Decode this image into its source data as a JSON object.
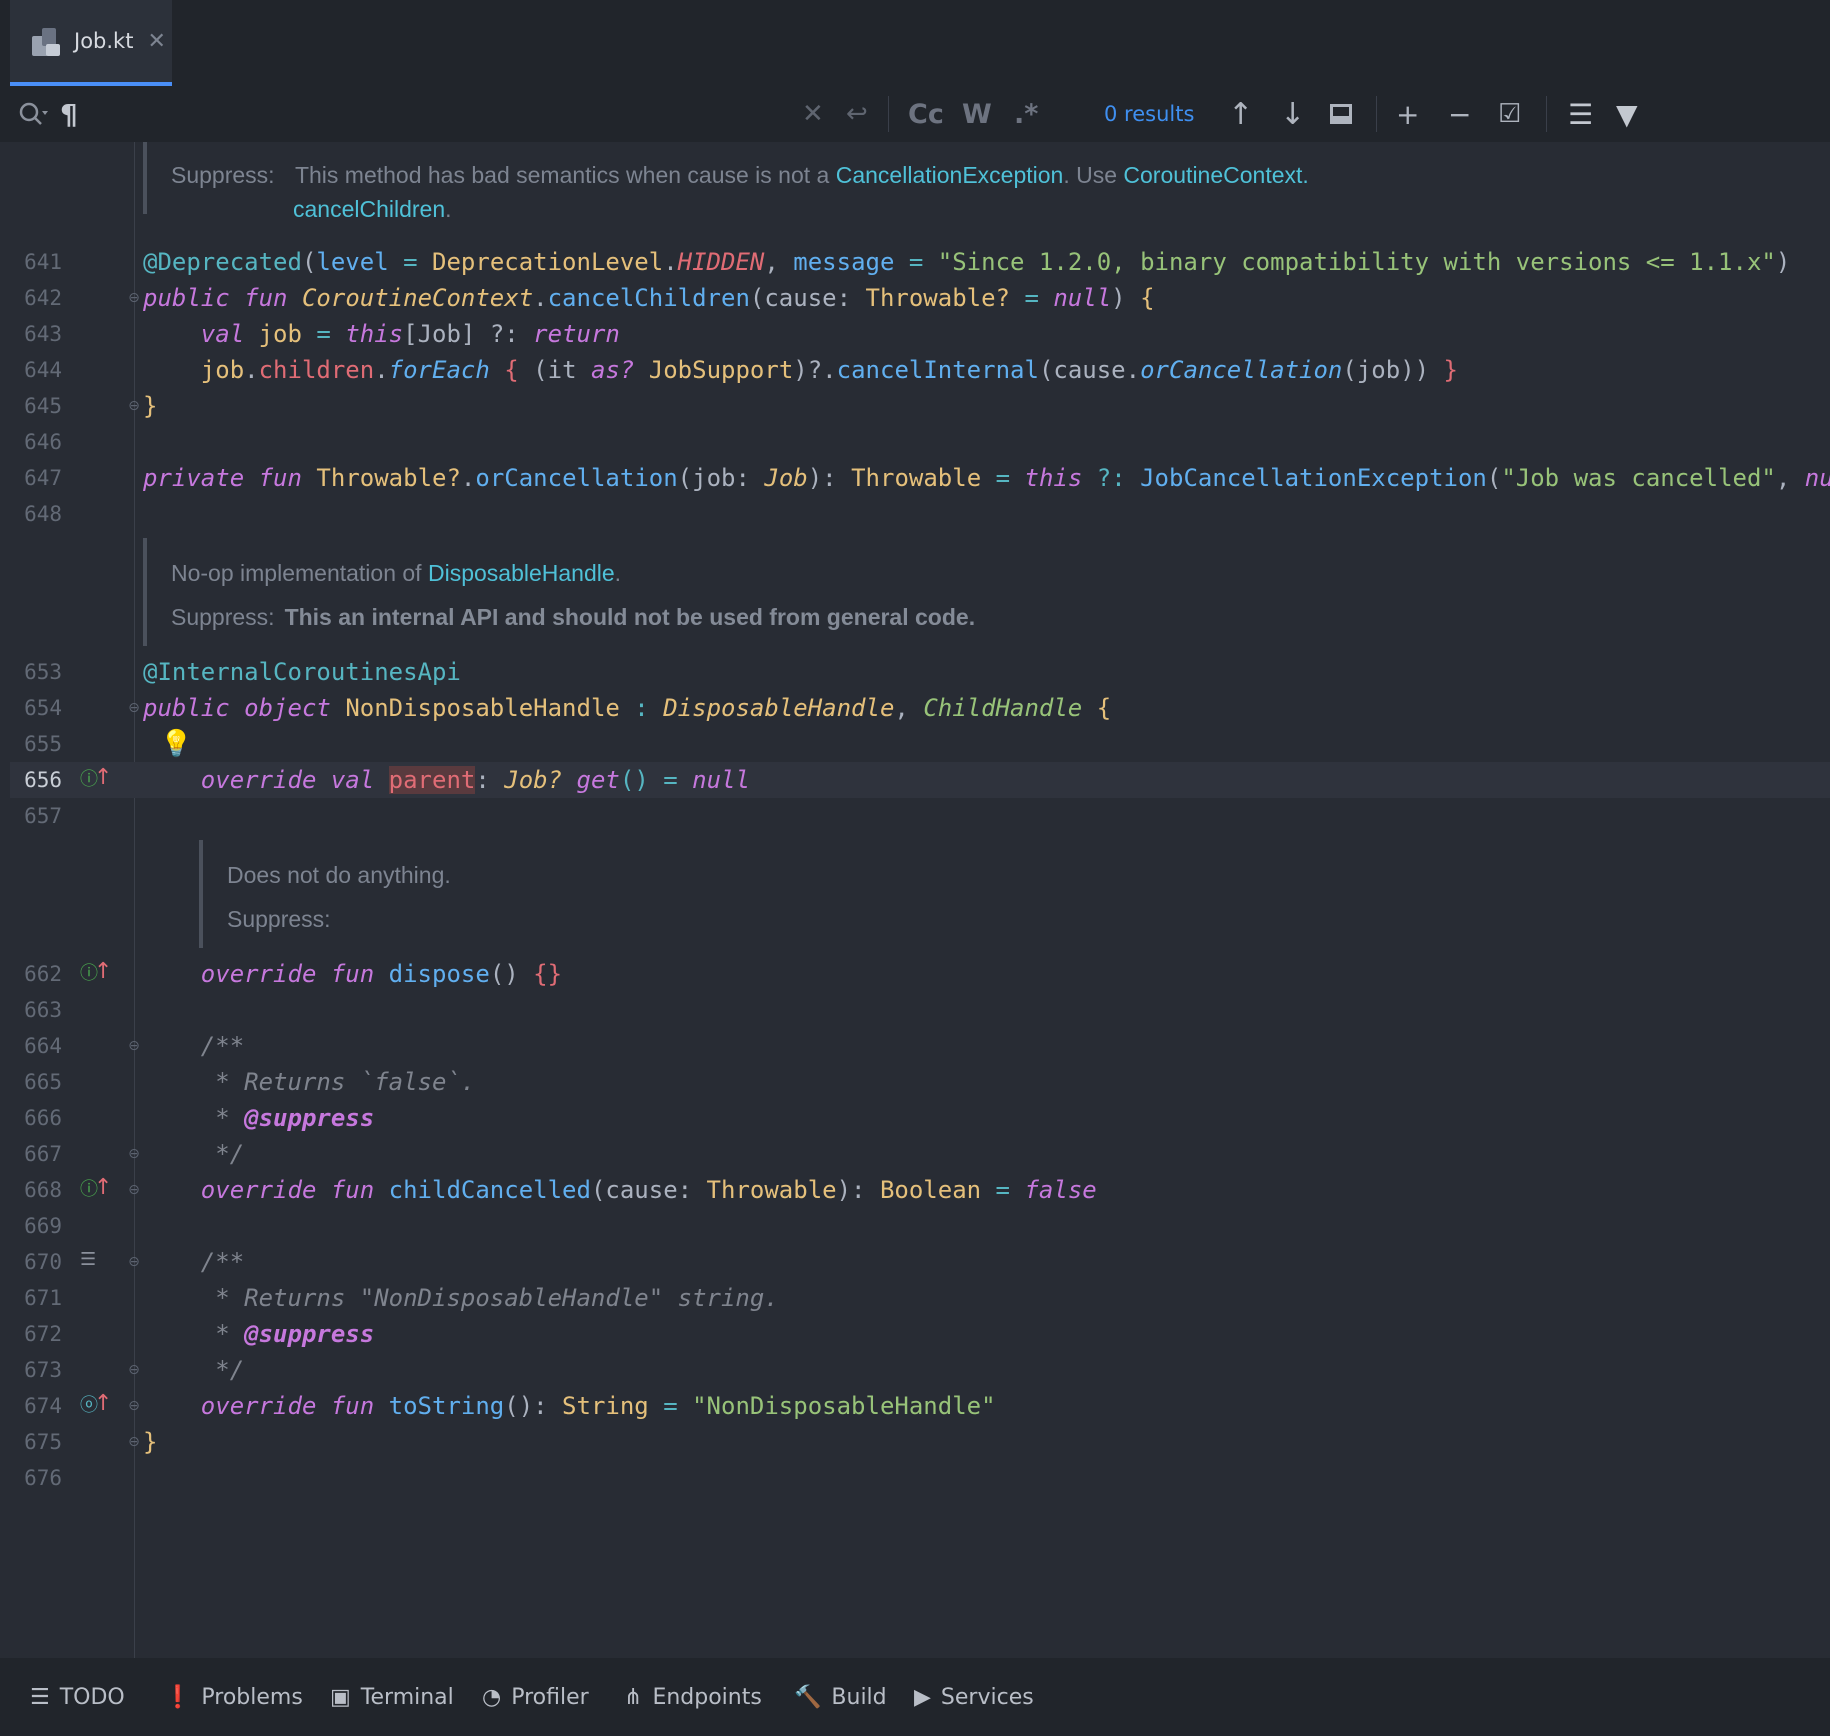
{
  "tab": {
    "label": "Job.kt",
    "close": "✕"
  },
  "findbar": {
    "search_icon": "🔍",
    "paragraph": "¶",
    "clear": "✕",
    "wrap": "↩",
    "match_case": "Cc",
    "words": "W",
    "regex": ".*",
    "results": "0 results",
    "up": "↑",
    "down": "↓",
    "add_cursor": "+",
    "remove_cursor": "−",
    "select_all": "☑",
    "multiline": "☰",
    "filter": "▼"
  },
  "doc1": {
    "suppress_label": "Suppress:",
    "text_a": "This method has bad semantics when cause is not a ",
    "link_a": "CancellationException",
    "text_b": ". Use ",
    "link_b": "CoroutineContext.",
    "link_c": "cancelChildren",
    "text_c": "."
  },
  "doc2": {
    "line1_a": "No-op implementation of ",
    "line1_link": "DisposableHandle",
    "line1_b": ".",
    "suppress_label": "Suppress:",
    "suppress_text": "This an internal API and should not be used from general code."
  },
  "doc3": {
    "line1": "Does not do anything.",
    "suppress_label": "Suppress:"
  },
  "lines": {
    "641": "641",
    "642": "642",
    "643": "643",
    "644": "644",
    "645": "645",
    "646": "646",
    "647": "647",
    "648": "648",
    "653": "653",
    "654": "654",
    "655": "655",
    "656": "656",
    "657": "657",
    "662": "662",
    "663": "663",
    "664": "664",
    "665": "665",
    "666": "666",
    "667": "667",
    "668": "668",
    "669": "669",
    "670": "670",
    "671": "671",
    "672": "672",
    "673": "673",
    "674": "674",
    "675": "675",
    "676": "676"
  },
  "code": {
    "l641": {
      "ann": "@Deprecated",
      "p1": "(",
      "a1": "level",
      "p2": " = ",
      "t1": "DeprecationLevel",
      "p3": ".",
      "c1": "HIDDEN",
      "p4": ", ",
      "a2": "message",
      "p5": " = ",
      "s1": "\"Since 1.2.0, binary compatibility with versions <= 1.1.x\"",
      "p6": ")"
    },
    "l642": {
      "k1": "public",
      "k2": "fun",
      "t1": "CoroutineContext",
      "p1": ".",
      "f1": "cancelChildren",
      "p2": "(cause: ",
      "t2": "Throwable?",
      "p3": " = ",
      "k3": "null",
      "p4": ") ",
      "b1": "{"
    },
    "l643": {
      "k1": "val",
      "v1": "job",
      "p1": " = ",
      "k2": "this",
      "p2": "[Job] ?: ",
      "k3": "return"
    },
    "l644": {
      "v1": "job",
      "p1": ".",
      "pr1": "children",
      "p2": ".",
      "f1": "forEach",
      "b1": "{",
      "p3": " (it ",
      "k1": "as?",
      "t1": " JobSupport",
      "p4": ")?.",
      "f2": "cancelInternal",
      "p5": "(cause.",
      "f3": "orCancellation",
      "p6": "(job)) ",
      "b2": "}"
    },
    "l645": {
      "b1": "}"
    },
    "l647": {
      "k1": "private",
      "k2": "fun",
      "t1": "Throwable?",
      "p1": ".",
      "f1": "orCancellation",
      "p2": "(job: ",
      "t2": "Job",
      "p3": "): ",
      "t3": "Throwable",
      "p4": " = ",
      "k3": "this",
      "p5": " ?: ",
      "f2": "JobCancellationException",
      "p6": "(",
      "s1": "\"Job was cancelled\"",
      "p7": ", ",
      "k4": "null",
      "p8": ","
    },
    "l653": {
      "ann": "@InternalCoroutinesApi"
    },
    "l654": {
      "k1": "public",
      "k2": "object",
      "t1": "NonDisposableHandle",
      "p1": " : ",
      "i1": "DisposableHandle",
      "p2": ", ",
      "i2": "ChildHandle",
      "b1": " {"
    },
    "l656": {
      "k1": "override",
      "k2": "val",
      "hl": "parent",
      "p1": ": ",
      "t1": "Job?",
      "k3": "get",
      "p2": "() = ",
      "k4": "null"
    },
    "l662": {
      "k1": "override",
      "k2": "fun",
      "f1": "dispose",
      "p1": "() ",
      "b1": "{}"
    },
    "l664": {
      "c": "/**"
    },
    "l665": {
      "c": " * Returns `false`."
    },
    "l666": {
      "c": " * ",
      "tag": "@suppress"
    },
    "l667": {
      "c": " */"
    },
    "l668": {
      "k1": "override",
      "k2": "fun",
      "f1": "childCancelled",
      "p1": "(cause: ",
      "t1": "Throwable",
      "p2": "): ",
      "t2": "Boolean",
      "p3": " = ",
      "k3": "false"
    },
    "l670": {
      "c": "/**"
    },
    "l671": {
      "c": " * Returns \"NonDisposableHandle\" string."
    },
    "l672": {
      "c": " * ",
      "tag": "@suppress"
    },
    "l673": {
      "c": " */"
    },
    "l674": {
      "k1": "override",
      "k2": "fun",
      "f1": "toString",
      "p1": "(): ",
      "t1": "String",
      "p2": " = ",
      "s1": "\"NonDisposableHandle\""
    },
    "l675": {
      "b1": "}"
    }
  },
  "bottom": {
    "todo": "TODO",
    "problems": "Problems",
    "terminal": "Terminal",
    "profiler": "Profiler",
    "endpoints": "Endpoints",
    "build": "Build",
    "services": "Services"
  }
}
